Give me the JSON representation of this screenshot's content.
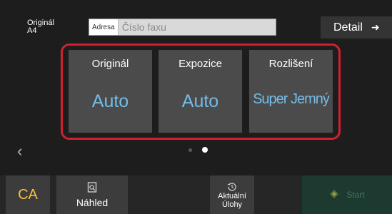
{
  "original": {
    "label": "Originál",
    "size": "A4"
  },
  "address": {
    "button_label": "Adresa",
    "placeholder": "Číslo faxu"
  },
  "detail": {
    "label": "Detail",
    "icon": "arrow-right-icon"
  },
  "tiles": [
    {
      "label": "Originál",
      "value": "Auto"
    },
    {
      "label": "Expozice",
      "value": "Auto"
    },
    {
      "label": "Rozlišení",
      "value": "Super Jemný"
    }
  ],
  "pager": {
    "prev_icon": "chevron-left-icon",
    "page_count": 2,
    "current_page": 2
  },
  "bottom": {
    "ca_label": "CA",
    "preview_label": "Náhled",
    "jobs_label_line1": "Aktuální",
    "jobs_label_line2": "Úlohy",
    "start_label": "Start"
  },
  "colors": {
    "value_blue": "#74bde9",
    "highlight_red": "#d2202f",
    "ca_yellow": "#f5c23a",
    "start_disabled": "#1d3a30"
  }
}
